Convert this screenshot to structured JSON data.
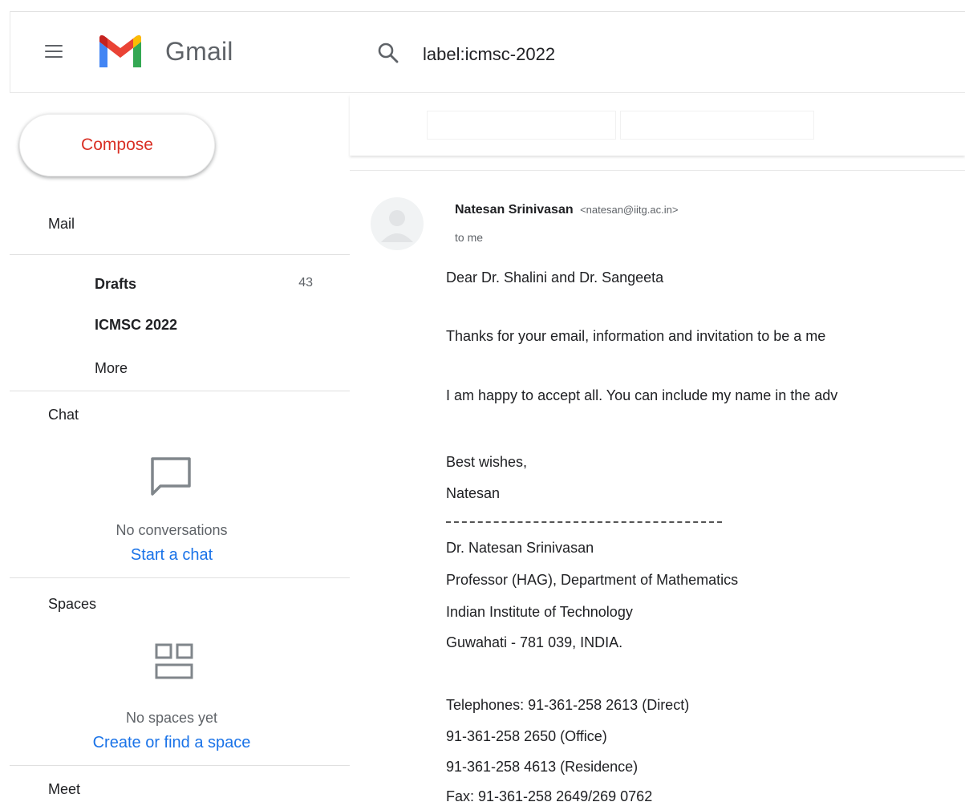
{
  "header": {
    "app_name": "Gmail",
    "search_value": "label:icmsc-2022"
  },
  "sidebar": {
    "compose_label": "Compose",
    "mail_title": "Mail",
    "items": [
      {
        "label": "Drafts",
        "count": "43"
      },
      {
        "label": "ICMSC 2022",
        "count": ""
      },
      {
        "label": "More",
        "count": ""
      }
    ],
    "chat": {
      "title": "Chat",
      "empty_text": "No conversations",
      "link": "Start a chat"
    },
    "spaces": {
      "title": "Spaces",
      "empty_text": "No spaces yet",
      "link": "Create or find a space"
    },
    "meet_title": "Meet"
  },
  "message": {
    "sender_name": "Natesan Srinivasan",
    "sender_email": "<natesan@iitg.ac.in>",
    "to": "to me",
    "lines": [
      "Dear Dr. Shalini and Dr. Sangeeta",
      "Thanks for your email, information and invitation to be a me",
      "I am happy to accept all. You can include my name in the adv",
      "Best wishes,",
      "Natesan",
      "Dr. Natesan Srinivasan",
      "Professor (HAG), Department of Mathematics",
      "Indian Institute of Technology",
      "Guwahati - 781 039, INDIA.",
      "Telephones: 91-361-258 2613 (Direct)",
      "91-361-258 2650 (Office)",
      "91-361-258 4613 (Residence)",
      "Fax: 91-361-258 2649/269 0762"
    ]
  },
  "colors": {
    "compose_text": "#d93025",
    "link": "#1a73e8",
    "gmail_red": "#ea4335",
    "gmail_blue": "#4285f4",
    "gmail_green": "#34a853",
    "gmail_yellow": "#fbbc04"
  },
  "icons": [
    "menu-icon",
    "gmail-logo",
    "search-icon",
    "chat-bubble-icon",
    "spaces-grid-icon",
    "avatar-icon"
  ]
}
